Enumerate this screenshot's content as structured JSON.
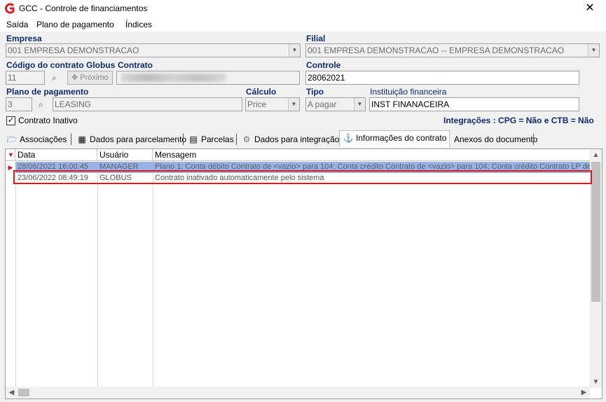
{
  "window": {
    "title": "GCC - Controle de financiamentos",
    "close_glyph": "✕"
  },
  "menu": [
    "Saída",
    "Plano de pagamento",
    "Índices"
  ],
  "form": {
    "empresa": {
      "label": "Empresa",
      "value": "001 EMPRESA DEMONSTRACAO"
    },
    "filial": {
      "label": "Filial",
      "value": "001 EMPRESA DEMONSTRACAO -- EMPRESA DEMONSTRACAO"
    },
    "codigo_contrato": {
      "label": "Código do contrato Globus",
      "value": "11"
    },
    "contrato": {
      "label": "Contrato"
    },
    "proximo_button": "Próximo",
    "controle": {
      "label": "Controle",
      "value": "28062021"
    },
    "plano_pagamento": {
      "label": "Plano de pagamento",
      "code": "3",
      "value": "LEASING"
    },
    "calculo": {
      "label": "Cálculo",
      "value": "Price"
    },
    "tipo": {
      "label": "Tipo",
      "value": "A pagar"
    },
    "instituicao": {
      "label": "Instituição financeira",
      "value": "INST FINANACEIRA"
    },
    "contrato_inativo": {
      "label": "Contrato Inativo",
      "checked": true
    },
    "integracoes": "Integrações : CPG = Não e CTB = Não"
  },
  "tabs": [
    {
      "label": "Associações",
      "icon": "folder-icon"
    },
    {
      "label": "Dados para parcelamento",
      "icon": "calculator-icon"
    },
    {
      "label": "Parcelas",
      "icon": "document-icon"
    },
    {
      "label": "Dados para integração",
      "icon": "gear-icon"
    },
    {
      "label": "Informações do contrato",
      "icon": "anchor-icon",
      "active": true
    },
    {
      "label": "Anexos do documento",
      "icon": ""
    }
  ],
  "grid": {
    "columns": [
      "Data",
      "Usuário",
      "Mensagem"
    ],
    "rows": [
      {
        "data": "28/06/2021 16:00:45",
        "usuario": "MANAGER",
        "mensagem": "Plano 1: Conta débito Contrato de <vazio> para 104; Conta crédito Contrato de <vazio> para 104; Conta crédito Contrato LP de <",
        "selected": true
      },
      {
        "data": "23/06/2022 08:49:19",
        "usuario": "GLOBUS",
        "mensagem": "Contrato inativado automaticamente pelo sistema",
        "highlighted": true
      }
    ]
  },
  "colors": {
    "label": "#0e2c6e",
    "selected_row": "#9ab1e3",
    "highlight_box": "#e0191f",
    "indicator": "#d0102a"
  }
}
